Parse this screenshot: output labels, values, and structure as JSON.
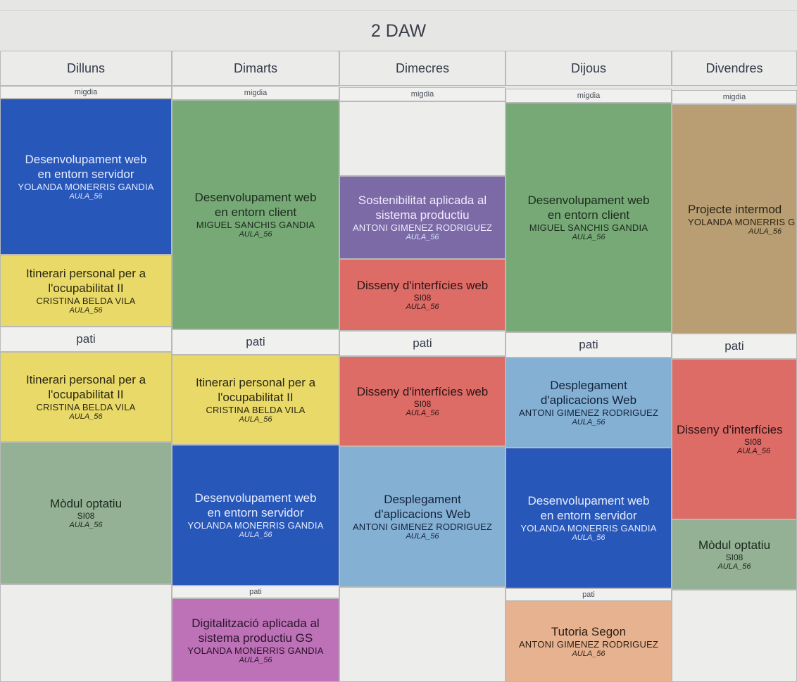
{
  "title": "2 DAW",
  "days": [
    "Dilluns",
    "Dimarts",
    "Dimecres",
    "Dijous",
    "Divendres"
  ],
  "bands": {
    "midday": "migdia",
    "break": "pati"
  },
  "colors": {
    "blue": "#2757b8",
    "green": "#77a977",
    "purple": "#7b6aa6",
    "red": "#dd6b66",
    "yellow": "#e9d969",
    "tan": "#b89e72",
    "lightblue": "#84b0d4",
    "graygreen": "#94b095",
    "magenta": "#bd71b7",
    "peach": "#e6b290"
  },
  "blocks": {
    "mon1": {
      "line1": "Desenvolupament web",
      "line2": "en entorn servidor",
      "teacher": "YOLANDA MONERRIS GANDIA",
      "room": "AULA_56"
    },
    "mon2": {
      "line1": "Itinerari personal per a",
      "line2": "l'ocupabilitat II",
      "teacher": "CRISTINA BELDA VILA",
      "room": "AULA_56"
    },
    "mon3": {
      "line1": "Itinerari personal per a",
      "line2": "l'ocupabilitat II",
      "teacher": "CRISTINA BELDA VILA",
      "room": "AULA_56"
    },
    "mon4": {
      "line1": "Mòdul optatiu",
      "code": "SI08",
      "room": "AULA_56"
    },
    "tue1": {
      "line1": "Desenvolupament web",
      "line2": "en entorn client",
      "teacher": "MIGUEL SANCHIS GANDIA",
      "room": "AULA_56"
    },
    "tue2": {
      "line1": "Itinerari personal per a",
      "line2": "l'ocupabilitat II",
      "teacher": "CRISTINA BELDA VILA",
      "room": "AULA_56"
    },
    "tue3": {
      "line1": "Desenvolupament web",
      "line2": "en entorn servidor",
      "teacher": "YOLANDA MONERRIS GANDIA",
      "room": "AULA_56"
    },
    "tue4": {
      "line1": "Digitalització aplicada al",
      "line2": "sistema productiu GS",
      "teacher": "YOLANDA MONERRIS GANDIA",
      "room": "AULA_56"
    },
    "wed1": {
      "line1": "Sostenibilitat aplicada al",
      "line2": "sistema productiu",
      "teacher": "ANTONI GIMENEZ RODRIGUEZ",
      "room": "AULA_56"
    },
    "wed2": {
      "line1": "Disseny d'interfícies web",
      "code": "SI08",
      "room": "AULA_56"
    },
    "wed3": {
      "line1": "Disseny d'interfícies web",
      "code": "SI08",
      "room": "AULA_56"
    },
    "wed4": {
      "line1": "Desplegament",
      "line2": "d'aplicacions Web",
      "teacher": "ANTONI GIMENEZ RODRIGUEZ",
      "room": "AULA_56"
    },
    "thu1": {
      "line1": "Desenvolupament web",
      "line2": "en entorn client",
      "teacher": "MIGUEL SANCHIS GANDIA",
      "room": "AULA_56"
    },
    "thu2": {
      "line1": "Desplegament",
      "line2": "d'aplicacions Web",
      "teacher": "ANTONI GIMENEZ RODRIGUEZ",
      "room": "AULA_56"
    },
    "thu3": {
      "line1": "Desenvolupament web",
      "line2": "en entorn servidor",
      "teacher": "YOLANDA MONERRIS GANDIA",
      "room": "AULA_56"
    },
    "thu4": {
      "line1": "Tutoria Segon",
      "teacher": "ANTONI GIMENEZ RODRIGUEZ",
      "room": "AULA_56"
    },
    "fri1": {
      "line1": "Projecte intermod",
      "teacher": "YOLANDA MONERRIS G",
      "room": "AULA_56"
    },
    "fri2": {
      "line1": "Disseny d'interfícies",
      "code": "SI08",
      "room": "AULA_56"
    },
    "fri3": {
      "line1": "Mòdul optatiu",
      "code": "SI08",
      "room": "AULA_56"
    }
  }
}
